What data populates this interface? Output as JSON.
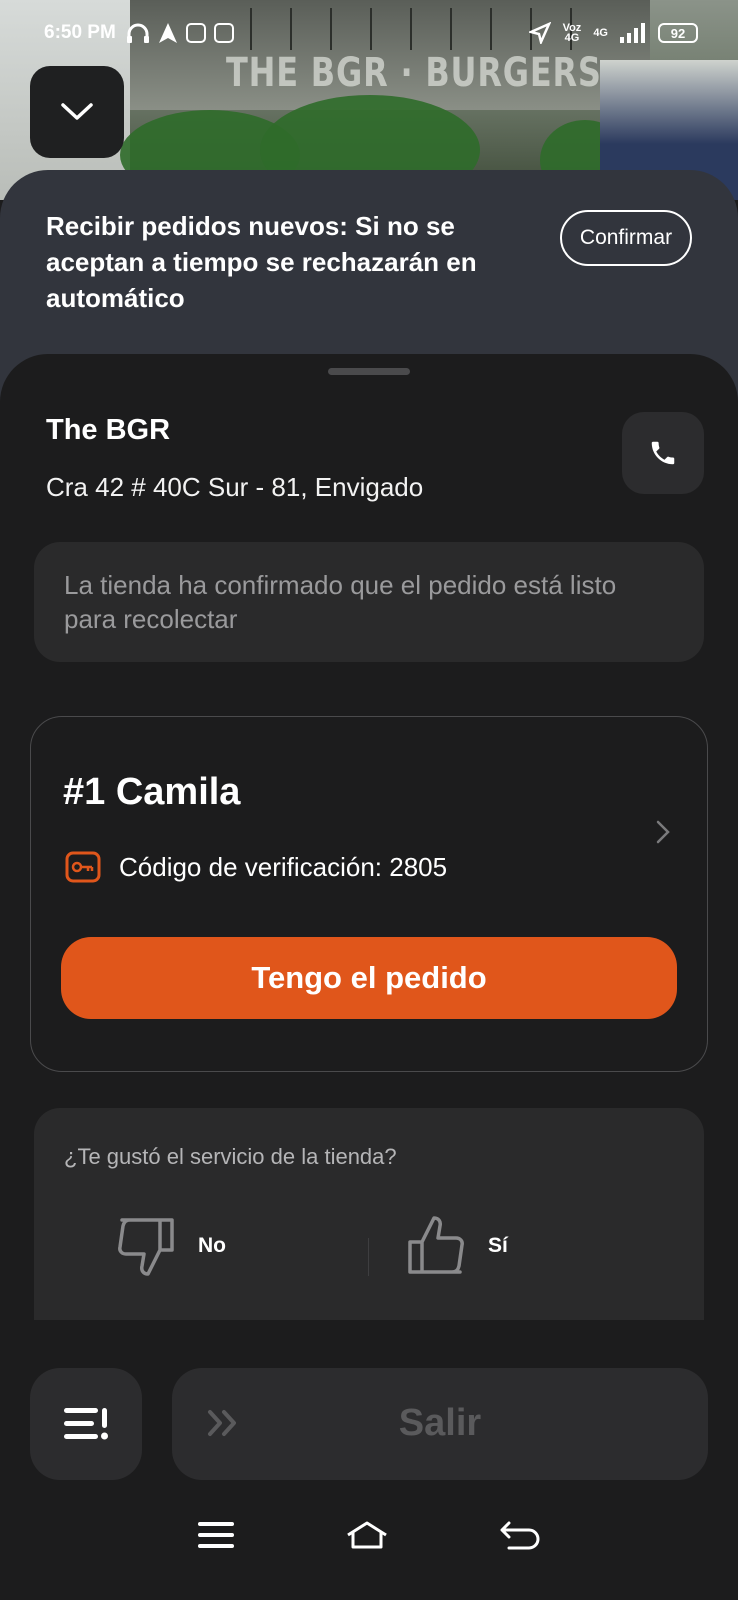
{
  "status_bar": {
    "time": "6:50 PM",
    "network_label": "Voz\n4G",
    "network_type": "4G",
    "battery": "92"
  },
  "background": {
    "sign_text": "THE BGR · BURGERS"
  },
  "notice": {
    "text": "Recibir pedidos nuevos: Si no se aceptan a tiempo se rechazarán en automático",
    "confirm_label": "Confirmar"
  },
  "store": {
    "name": "The BGR",
    "address": "Cra 42 # 40C Sur - 81, Envigado"
  },
  "status_message": "La tienda ha confirmado que el pedido está listo para recolectar",
  "order": {
    "title": "#1 Camila",
    "verification_label": "Código de verificación: 2805",
    "got_order_label": "Tengo el pedido"
  },
  "rating": {
    "question": "¿Te gustó el servicio de la tienda?",
    "no_label": "No",
    "yes_label": "Sí"
  },
  "bottom": {
    "exit_label": "Salir"
  },
  "colors": {
    "accent": "#e0561b",
    "sheet_bg": "#1c1c1d",
    "notice_bg": "#32353d",
    "card_bg": "#2a2a2b"
  }
}
